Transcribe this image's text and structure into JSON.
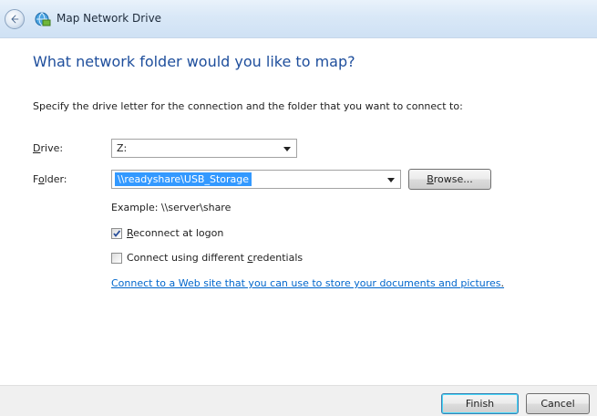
{
  "window": {
    "title": "Map Network Drive"
  },
  "heading": "What network folder would you like to map?",
  "instruction": "Specify the drive letter for the connection and the folder that you want to connect to:",
  "drive": {
    "label_accel": "D",
    "label_rest": "rive:",
    "value": "Z:"
  },
  "folder": {
    "label_pre": "F",
    "label_accel": "o",
    "label_rest": "lder:",
    "value": "\\\\readyshare\\USB_Storage"
  },
  "browse": {
    "accel": "B",
    "rest": "rowse..."
  },
  "example": "Example: \\\\server\\share",
  "reconnect": {
    "checked": true,
    "accel": "R",
    "rest": "econnect at logon"
  },
  "credentials": {
    "checked": false,
    "pre": "Connect using different ",
    "accel": "c",
    "rest": "redentials"
  },
  "link": {
    "text": "Connect to a Web site that you can use to store your documents and pictures",
    "trail": "."
  },
  "buttons": {
    "finish": "Finish",
    "cancel": "Cancel"
  },
  "colors": {
    "heading": "#1e4e9c",
    "link": "#0066cc",
    "selection": "#3399ff"
  },
  "icons": {
    "back": "back-arrow-icon",
    "app": "network-drive-icon",
    "check": "checkmark-icon"
  }
}
